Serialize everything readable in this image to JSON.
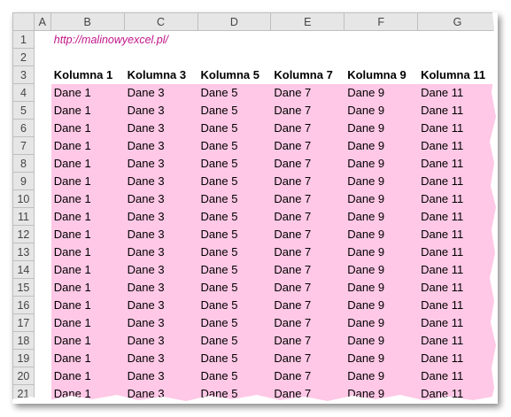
{
  "columns": [
    "A",
    "B",
    "C",
    "D",
    "E",
    "F",
    "G"
  ],
  "link_text": "http://malinowyexcel.pl/",
  "headers": [
    "Kolumna 1",
    "Kolumna 3",
    "Kolumna 5",
    "Kolumna 7",
    "Kolumna 9",
    "Kolumna 11"
  ],
  "row_numbers": [
    "1",
    "2",
    "3",
    "4",
    "5",
    "6",
    "7",
    "8",
    "9",
    "10",
    "11",
    "12",
    "13",
    "14",
    "15",
    "16",
    "17",
    "18",
    "19",
    "20",
    "21"
  ],
  "data_values": [
    "Dane 1",
    "Dane 3",
    "Dane 5",
    "Dane 7",
    "Dane 9",
    "Dane 11"
  ],
  "data_row_count": 18,
  "colors": {
    "fill": "#ffc8e6",
    "link": "#c0178a",
    "header_bg": "#e6e6e6"
  }
}
